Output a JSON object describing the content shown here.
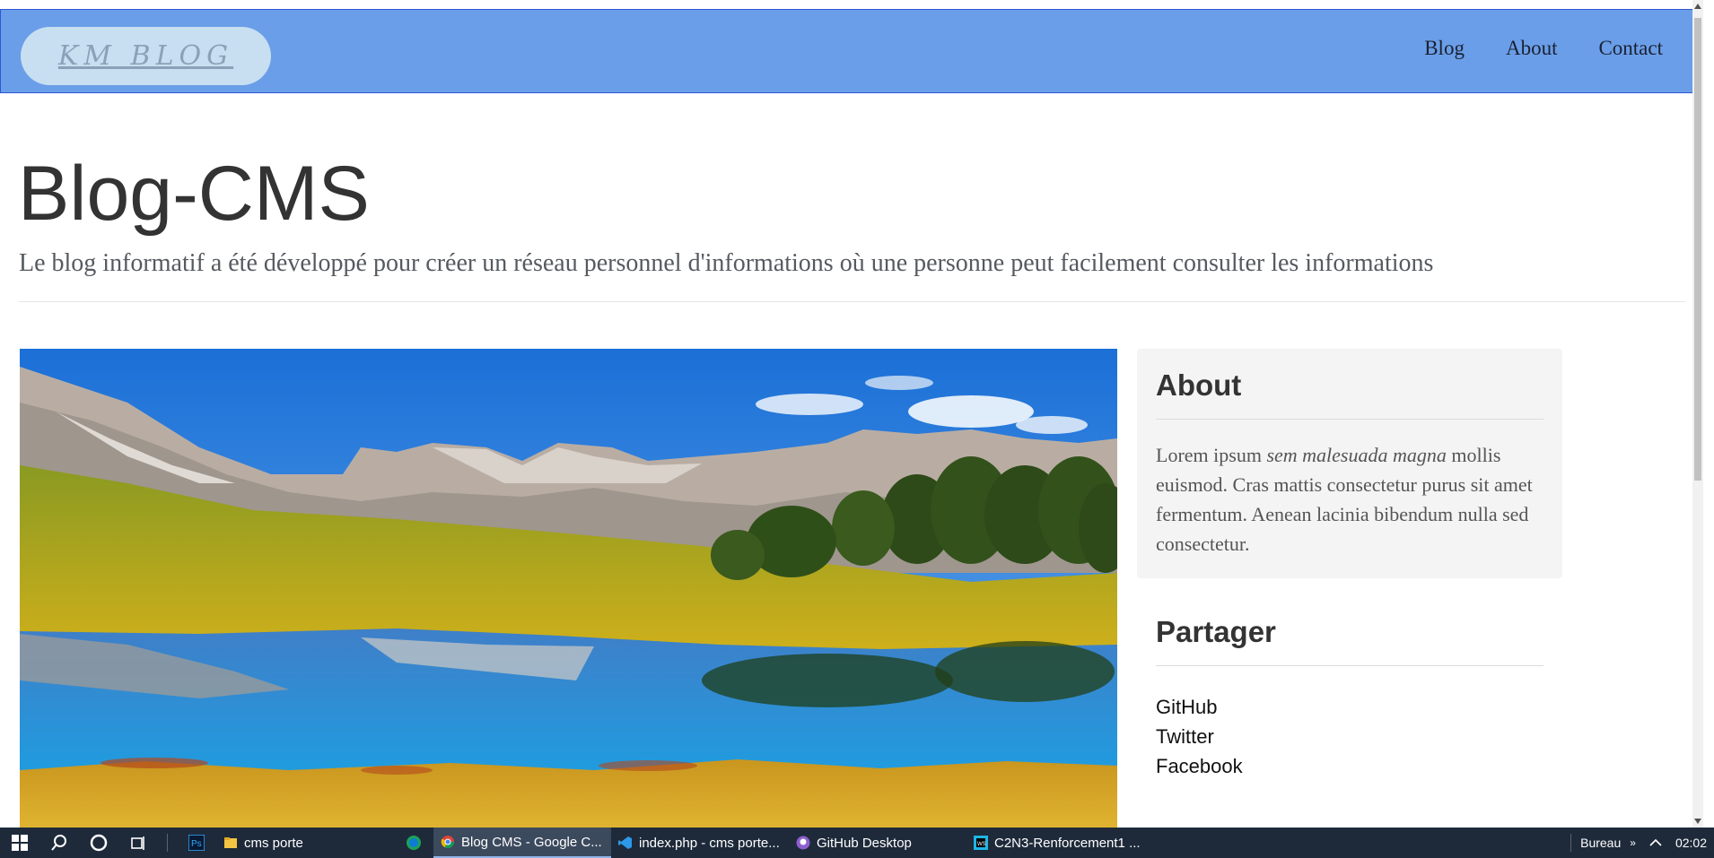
{
  "navbar": {
    "brand": "KM BLOG",
    "links": [
      "Blog",
      "About",
      "Contact"
    ]
  },
  "header": {
    "title": "Blog-CMS",
    "subtitle": "Le blog informatif a été développé pour créer un réseau personnel d'informations où une personne peut facilement consulter les informations"
  },
  "hero_image": {
    "description_icon": "mountain-lake-landscape"
  },
  "sidebar": {
    "about": {
      "title": "About",
      "text_start": "Lorem ipsum ",
      "text_emphasis": "sem malesuada magna",
      "text_end": " mollis euismod. Cras mattis consectetur purus sit amet fermentum. Aenean lacinia bibendum nulla sed consectetur."
    },
    "share": {
      "title": "Partager",
      "links": [
        "GitHub",
        "Twitter",
        "Facebook"
      ]
    }
  },
  "taskbar": {
    "items": [
      {
        "icon": "folder-icon",
        "label": "cms porte"
      },
      {
        "icon": "chrome-icon",
        "label": "Blog CMS - Google C..."
      },
      {
        "icon": "vscode-icon",
        "label": "index.php - cms porte..."
      },
      {
        "icon": "github-icon",
        "label": "GitHub Desktop"
      },
      {
        "icon": "webstorm-icon",
        "label": "C2N3-Renforcement1 ..."
      }
    ],
    "desktop_label": "Bureau",
    "clock": "02:02"
  },
  "colors": {
    "navbar_bg": "#6a9ee8",
    "navbar_border": "#2f57d6",
    "brand_pill": "#c8dff1",
    "taskbar_bg": "#1e2a3a"
  }
}
